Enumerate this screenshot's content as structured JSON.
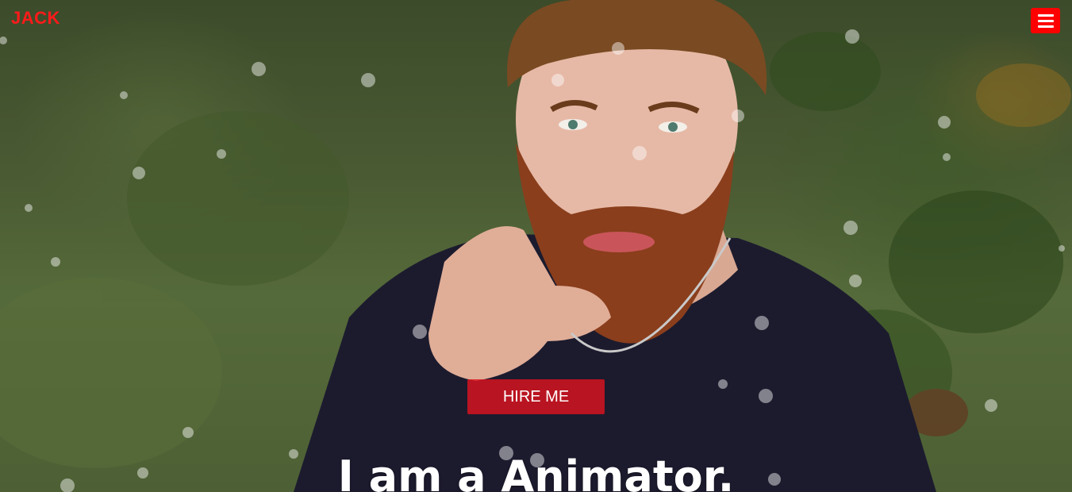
{
  "brand": {
    "name": "JACK",
    "color": "#ff1a1a"
  },
  "nav": {
    "menu_icon": "hamburger-menu-icon",
    "menu_color": "#ff0000"
  },
  "hero": {
    "cta_label": "HIRE ME",
    "headline": "I am a Animator.",
    "image": "bearded man in dark sweater against green foliage"
  }
}
